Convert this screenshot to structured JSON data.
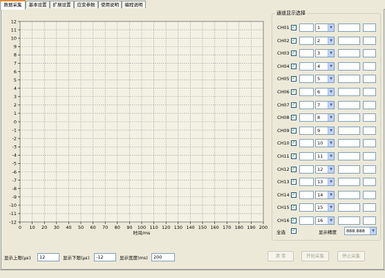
{
  "tabs": [
    {
      "label": "数据采集"
    },
    {
      "label": "基本设置"
    },
    {
      "label": "扩展设置"
    },
    {
      "label": "应变参数"
    },
    {
      "label": "使用说明"
    },
    {
      "label": "编程说明"
    }
  ],
  "chart": {
    "xlabel": "时间/ms",
    "x_ticks": [
      "0",
      "10",
      "20",
      "30",
      "40",
      "50",
      "60",
      "70",
      "80",
      "90",
      "100",
      "110",
      "120",
      "130",
      "140",
      "150",
      "160",
      "170",
      "180",
      "190",
      "200"
    ],
    "y_ticks": [
      "12",
      "11",
      "10",
      "9",
      "8",
      "7",
      "6",
      "5",
      "4",
      "3",
      "2",
      "1",
      "0",
      "-1",
      "-2",
      "-3",
      "-4",
      "-5",
      "-6",
      "-7",
      "-8",
      "-9",
      "-10",
      "-11",
      "-12"
    ]
  },
  "chart_data": {
    "type": "line",
    "title": "",
    "xlabel": "时间/ms",
    "ylabel": "",
    "xlim": [
      0,
      200
    ],
    "ylim": [
      -12,
      12
    ],
    "grid": true,
    "series": []
  },
  "channels": {
    "title": "通道显示选择",
    "items": [
      {
        "label": "CH01",
        "checked": true,
        "value": "1"
      },
      {
        "label": "CH02",
        "checked": true,
        "value": "2"
      },
      {
        "label": "CH03",
        "checked": true,
        "value": "3"
      },
      {
        "label": "CH04",
        "checked": true,
        "value": "4"
      },
      {
        "label": "CH05",
        "checked": true,
        "value": "5"
      },
      {
        "label": "CH06",
        "checked": true,
        "value": "6"
      },
      {
        "label": "CH07",
        "checked": true,
        "value": "7"
      },
      {
        "label": "CH08",
        "checked": true,
        "value": "8"
      },
      {
        "label": "CH09",
        "checked": true,
        "value": "9"
      },
      {
        "label": "CH10",
        "checked": true,
        "value": "10"
      },
      {
        "label": "CH11",
        "checked": true,
        "value": "11"
      },
      {
        "label": "CH12",
        "checked": true,
        "value": "12"
      },
      {
        "label": "CH13",
        "checked": true,
        "value": "13"
      },
      {
        "label": "CH14",
        "checked": true,
        "value": "14"
      },
      {
        "label": "CH15",
        "checked": true,
        "value": "15"
      },
      {
        "label": "CH16",
        "checked": true,
        "value": "16"
      }
    ],
    "select_all_label": "全选",
    "select_all_checked": true,
    "precision_label": "显示精度",
    "precision_value": "888.888"
  },
  "bottom": {
    "upper_label": "显示上限(με)",
    "upper_value": "12",
    "lower_label": "显示下限(με)",
    "lower_value": "-12",
    "width_label": "显示宽度(ms)",
    "width_value": "200",
    "clear_label": "清 零",
    "start_label": "开始采集",
    "stop_label": "停止采集"
  },
  "colors": {
    "plot_bg": "#f2f1e4",
    "grid": "#8f8f8f",
    "check": "#21a121"
  }
}
